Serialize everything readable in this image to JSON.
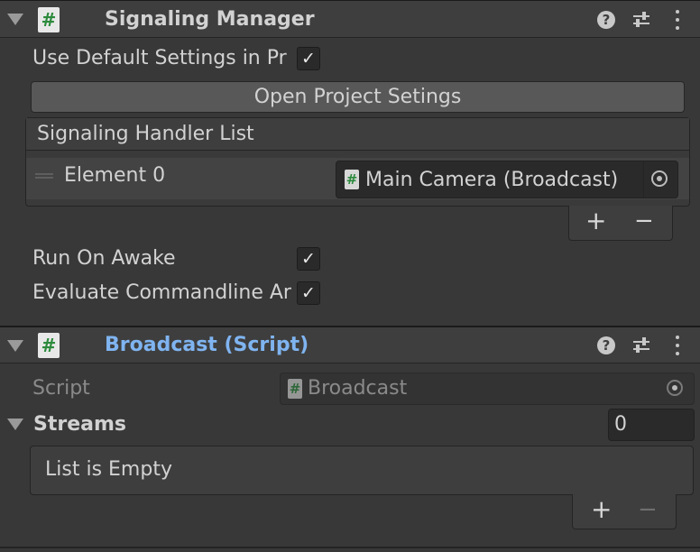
{
  "signaling_manager": {
    "title": "Signaling Manager",
    "use_default_settings_label": "Use Default Settings in Pr",
    "use_default_settings_checked": true,
    "open_project_settings_label": "Open Project Setings",
    "handler_list": {
      "header": "Signaling Handler List",
      "elements": [
        {
          "label": "Element 0",
          "value": "Main Camera (Broadcast)"
        }
      ]
    },
    "run_on_awake_label": "Run On Awake",
    "run_on_awake_checked": true,
    "evaluate_commandline_label": "Evaluate Commandline Ar",
    "evaluate_commandline_checked": true
  },
  "broadcast": {
    "title": "Broadcast (Script)",
    "script_label": "Script",
    "script_value": "Broadcast",
    "streams_label": "Streams",
    "streams_count": "0",
    "empty_list_text": "List is Empty"
  },
  "glyphs": {
    "hash": "#",
    "check": "✓",
    "help": "?",
    "plus": "+",
    "minus": "−"
  },
  "colors": {
    "background": "#383838",
    "header": "#3e3e3e",
    "script_title": "#7fb4f0",
    "hash_green": "#2c8a3c"
  }
}
